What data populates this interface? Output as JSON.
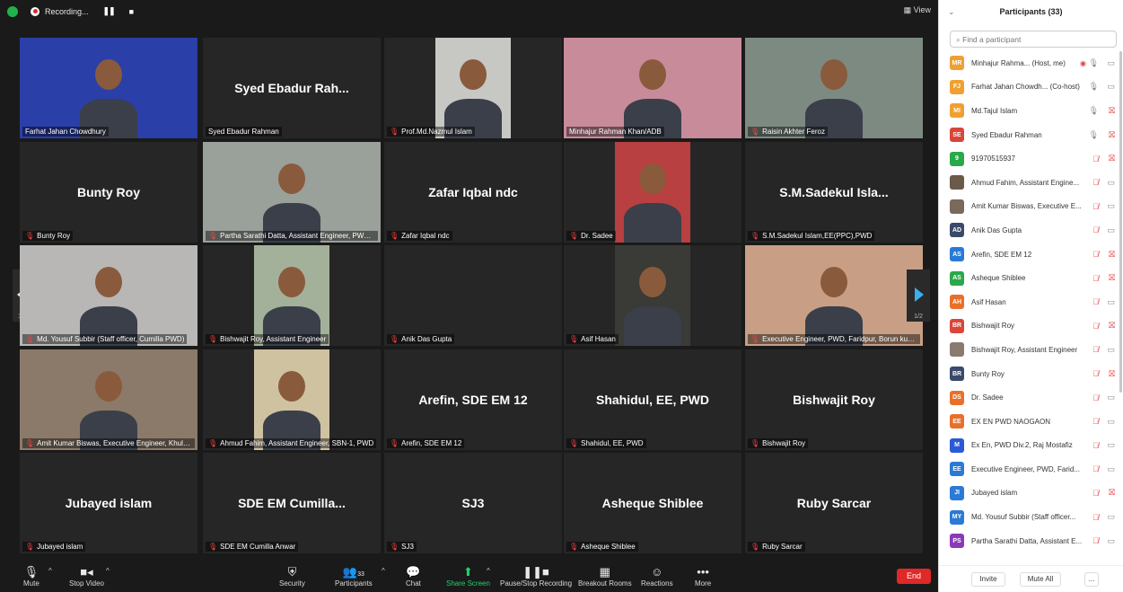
{
  "topbar": {
    "recording_label": "Recording...",
    "pause_glyph": "❚❚",
    "stop_glyph": "■",
    "view_label": "View"
  },
  "pagination": {
    "left": "1/2",
    "right": "1/2"
  },
  "tiles": [
    {
      "big": "",
      "name": "Farhat Jahan Chowdhury",
      "muted": false,
      "video": true,
      "active": true,
      "bg": "#2b3fa8"
    },
    {
      "big": "Syed Ebadur Rah...",
      "name": "Syed Ebadur Rahman",
      "muted": false,
      "video": false
    },
    {
      "big": "",
      "name": "Prof.Md.Nazmul Islam",
      "muted": true,
      "video": true,
      "bg": "#c7c7c4"
    },
    {
      "big": "",
      "name": "Minhajur Rahman Khan/ADB",
      "muted": false,
      "video": true,
      "bg": "#c88b9a"
    },
    {
      "big": "",
      "name": "Raisin Akhter Feroz",
      "muted": true,
      "video": true,
      "bg": "#7d8a82"
    },
    {
      "big": "Bunty Roy",
      "name": "Bunty Roy",
      "muted": true,
      "video": false
    },
    {
      "big": "",
      "name": "Partha Sarathi Datta, Assistant Engineer, PWD ...",
      "muted": true,
      "video": true,
      "bg": "#9aa09a"
    },
    {
      "big": "Zafar Iqbal ndc",
      "name": "Zafar Iqbal ndc",
      "muted": true,
      "video": false
    },
    {
      "big": "",
      "name": "Dr. Sadee",
      "muted": true,
      "video": true,
      "bg": "#b84040"
    },
    {
      "big": "S.M.Sadekul Isla...",
      "name": "S.M.Sadekul Islam,EE(PPC),PWD",
      "muted": true,
      "video": false
    },
    {
      "big": "",
      "name": "Md. Yousuf Subbir (Staff officer, Cumilla PWD)",
      "muted": true,
      "video": true,
      "bg": "#b9b6b6"
    },
    {
      "big": "",
      "name": "Bishwajit Roy, Assistant Engineer",
      "muted": true,
      "video": true,
      "bg": "#a4b19a"
    },
    {
      "big": "",
      "name": "Anik Das Gupta",
      "muted": true,
      "video": false
    },
    {
      "big": "",
      "name": "Asif Hasan",
      "muted": true,
      "video": true,
      "bg": "#3a3a36"
    },
    {
      "big": "",
      "name": "Executive Engineer, PWD, Faridpur, Borun kum...",
      "muted": true,
      "video": true,
      "bg": "#c89f84"
    },
    {
      "big": "",
      "name": "Amit Kumar Biswas, Executive Engineer, Khuln...",
      "muted": true,
      "video": true,
      "bg": "#8b7a6a"
    },
    {
      "big": "",
      "name": "Ahmud Fahim, Assistant Engineer, SBN-1, PWD",
      "muted": true,
      "video": true,
      "bg": "#cfc2a0"
    },
    {
      "big": "Arefin, SDE EM 12",
      "name": "Arefin, SDE EM 12",
      "muted": true,
      "video": false
    },
    {
      "big": "Shahidul, EE, PWD",
      "name": "Shahidul, EE, PWD",
      "muted": true,
      "video": false
    },
    {
      "big": "Bishwajit Roy",
      "name": "Bishwajit Roy",
      "muted": true,
      "video": false
    },
    {
      "big": "Jubayed islam",
      "name": "Jubayed islam",
      "muted": true,
      "video": false
    },
    {
      "big": "SDE EM Cumilla...",
      "name": "SDE EM Cumilla Anwar",
      "muted": true,
      "video": false
    },
    {
      "big": "SJ3",
      "name": "SJ3",
      "muted": true,
      "video": false
    },
    {
      "big": "Asheque Shiblee",
      "name": "Asheque Shiblee",
      "muted": true,
      "video": false
    },
    {
      "big": "Ruby Sarcar",
      "name": "Ruby Sarcar",
      "muted": true,
      "video": false
    }
  ],
  "toolbar": {
    "mute": "Mute",
    "stop_video": "Stop Video",
    "security": "Security",
    "participants": "Participants",
    "participants_count": "33",
    "chat": "Chat",
    "share_screen": "Share Screen",
    "pause_recording": "Pause/Stop Recording",
    "breakout": "Breakout Rooms",
    "reactions": "Reactions",
    "more": "More",
    "end": "End"
  },
  "panel": {
    "title": "Participants (33)",
    "search_placeholder": "Find a participant",
    "invite": "Invite",
    "mute_all": "Mute All",
    "more": "...",
    "participants": [
      {
        "initials": "MR",
        "color": "#f0a030",
        "name": "Minhajur Rahma... (Host, me)",
        "mic": "on",
        "cam": "on",
        "rec": true
      },
      {
        "initials": "FJ",
        "color": "#f0a030",
        "name": "Farhat Jahan Chowdh... (Co-host)",
        "mic": "talk",
        "cam": "on"
      },
      {
        "initials": "MI",
        "color": "#f0a030",
        "name": "Md.Tajul Islam",
        "mic": "on",
        "cam": "off"
      },
      {
        "initials": "SE",
        "color": "#d9453b",
        "name": "Syed Ebadur Rahman",
        "mic": "on",
        "cam": "off"
      },
      {
        "initials": "9",
        "color": "#2aa84a",
        "name": "91970515937",
        "mic": "off",
        "cam": "off"
      },
      {
        "initials": "",
        "color": "#6b5a4a",
        "name": "Ahmud Fahim, Assistant Engine...",
        "mic": "off",
        "cam": "on"
      },
      {
        "initials": "",
        "color": "#7a6a5c",
        "name": "Amit Kumar Biswas, Executive E...",
        "mic": "off",
        "cam": "on"
      },
      {
        "initials": "AD",
        "color": "#3a4a6a",
        "name": "Anik Das Gupta",
        "mic": "off",
        "cam": "on"
      },
      {
        "initials": "AS",
        "color": "#2a7ad6",
        "name": "Arefin, SDE EM 12",
        "mic": "off",
        "cam": "off"
      },
      {
        "initials": "AS",
        "color": "#2aa84a",
        "name": "Asheque Shiblee",
        "mic": "off",
        "cam": "off"
      },
      {
        "initials": "AH",
        "color": "#e8702a",
        "name": "Asif Hasan",
        "mic": "off",
        "cam": "on"
      },
      {
        "initials": "BR",
        "color": "#d9453b",
        "name": "Bishwajit Roy",
        "mic": "off",
        "cam": "off"
      },
      {
        "initials": "",
        "color": "#8a7a70",
        "name": "Bishwajit Roy, Assistant Engineer",
        "mic": "off",
        "cam": "on"
      },
      {
        "initials": "BR",
        "color": "#3a4a6a",
        "name": "Bunty Roy",
        "mic": "off",
        "cam": "off"
      },
      {
        "initials": "DS",
        "color": "#e8702a",
        "name": "Dr. Sadee",
        "mic": "off",
        "cam": "on"
      },
      {
        "initials": "EE",
        "color": "#e8702a",
        "name": "EX EN PWD NAOGAON",
        "mic": "off",
        "cam": "on"
      },
      {
        "initials": "M",
        "color": "#2a5ad6",
        "name": "Ex En, PWD Div.2, Raj Mostafiz",
        "mic": "off",
        "cam": "on"
      },
      {
        "initials": "EE",
        "color": "#2a7ad6",
        "name": "Executive Engineer, PWD, Farid...",
        "mic": "off",
        "cam": "on"
      },
      {
        "initials": "JI",
        "color": "#2a7ad6",
        "name": "Jubayed islam",
        "mic": "off",
        "cam": "off"
      },
      {
        "initials": "MY",
        "color": "#2a7ad6",
        "name": "Md. Yousuf Subbir (Staff officer...",
        "mic": "off",
        "cam": "on"
      },
      {
        "initials": "PS",
        "color": "#8a3ab9",
        "name": "Partha Sarathi Datta, Assistant E...",
        "mic": "off",
        "cam": "on"
      }
    ]
  }
}
